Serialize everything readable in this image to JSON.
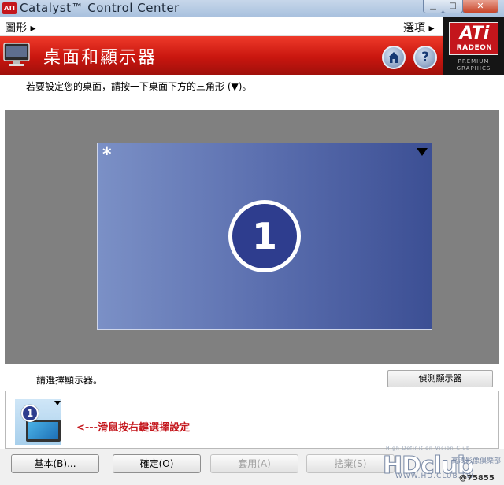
{
  "window": {
    "title": "Catalyst™ Control Center",
    "controls": {
      "minimize": "▁",
      "maximize": "□",
      "close": "✕"
    }
  },
  "menubar": {
    "left_menu": "圖形 ▸",
    "right_menu": "選項 ▸"
  },
  "header": {
    "title": "桌面和顯示器",
    "home_icon": "home-icon",
    "help_label": "?"
  },
  "logo": {
    "word": "ATi",
    "line1": "RADEON",
    "line2": "PREMIUM",
    "line3": "GRAPHICS"
  },
  "instruction": "若要設定您的桌面，請按一下桌面下方的三角形 (▼)。",
  "desktop": {
    "primary_marker": "*",
    "monitor_number": "1"
  },
  "select_display": {
    "label": "請選擇顯示器。",
    "detect_button": "偵測顯示器"
  },
  "thumbnail": {
    "badge": "1",
    "hint": "<---滑鼠按右鍵選擇設定"
  },
  "buttons": {
    "basic": "基本(B)...",
    "ok": "確定(O)",
    "apply": "套用(A)",
    "discard": "捨棄(S)"
  },
  "watermark": {
    "tagline": "High Definition Vision Club",
    "logo": "HDclub",
    "url": "WWW.HD.CLUB.TW",
    "cn": "高清影像俱樂部",
    "user": "@75855"
  },
  "colors": {
    "banner_red": "#c9160f",
    "desktop_blue": "#5b6faf",
    "hint_red": "#c4161c",
    "badge_blue": "#2e3d8e"
  }
}
